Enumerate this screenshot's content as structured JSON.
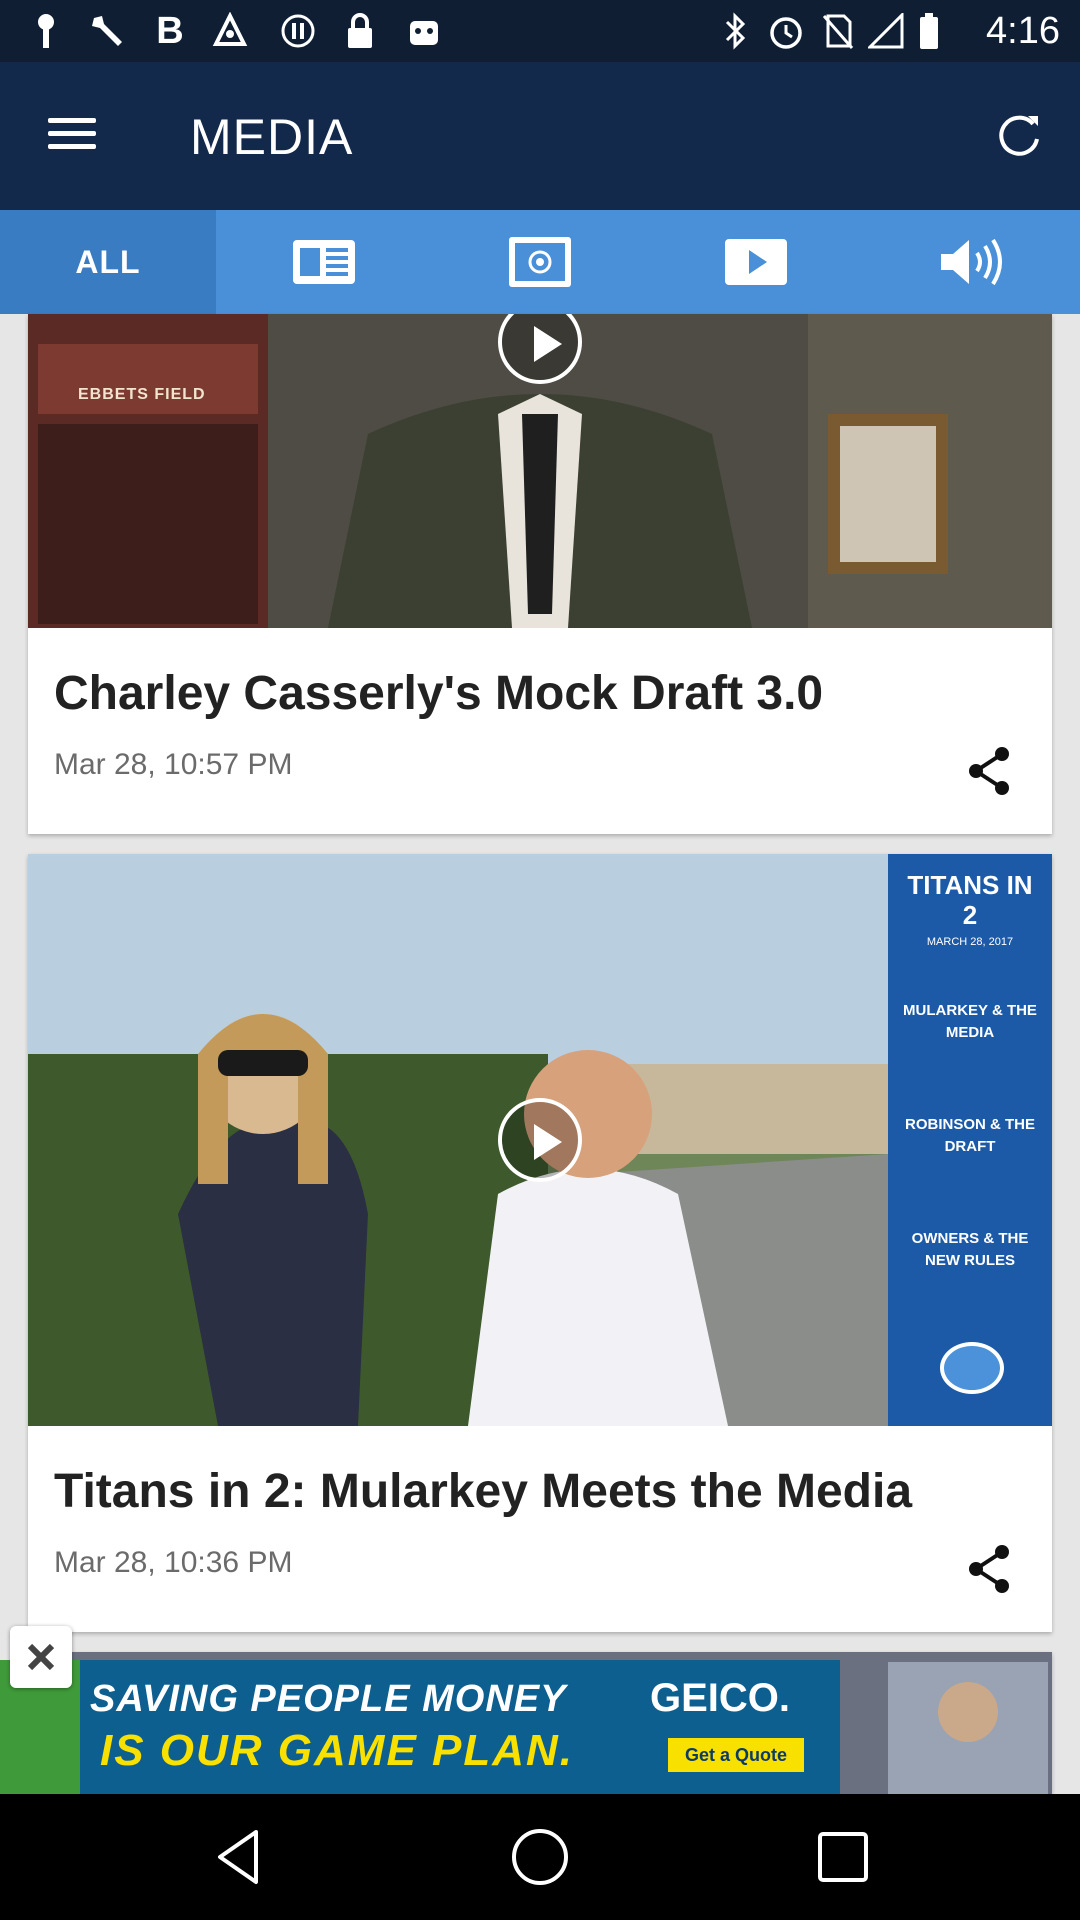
{
  "status_bar": {
    "time": "4:16",
    "left_icons": [
      "notification-icon",
      "wrench-icon",
      "bold-b-icon",
      "fake-gps-icon",
      "pause-icon",
      "lock-icon",
      "android-icon"
    ],
    "right_icons": [
      "bluetooth-icon",
      "alarm-icon",
      "no-sim-icon",
      "signal-icon",
      "battery-icon"
    ]
  },
  "app_bar": {
    "title": "MEDIA",
    "menu_icon": "hamburger-menu-icon",
    "refresh_icon": "refresh-icon",
    "background": "#13294b"
  },
  "tabs": [
    {
      "label": "ALL",
      "active": true
    },
    {
      "icon": "news-icon"
    },
    {
      "icon": "photo-icon"
    },
    {
      "icon": "video-icon"
    },
    {
      "icon": "audio-icon"
    }
  ],
  "tab_color": "#4a90d9",
  "cards": [
    {
      "title": "Charley Casserly's Mock Draft 3.0",
      "date": "Mar 28, 10:57 PM",
      "image_sign": "EBBETS FIELD"
    },
    {
      "title": "Titans in 2: Mularkey Meets the Media",
      "date": "Mar 28, 10:36 PM",
      "panel": {
        "heading": "TITANS IN 2",
        "date": "MARCH 28, 2017",
        "topics": [
          "MULARKEY & THE MEDIA",
          "ROBINSON & THE DRAFT",
          "OWNERS & THE NEW RULES"
        ]
      }
    }
  ],
  "ad": {
    "line1": "SAVING PEOPLE MONEY",
    "line2": "IS OUR GAME PLAN.",
    "brand": "GEICO.",
    "cta": "Get a Quote"
  }
}
